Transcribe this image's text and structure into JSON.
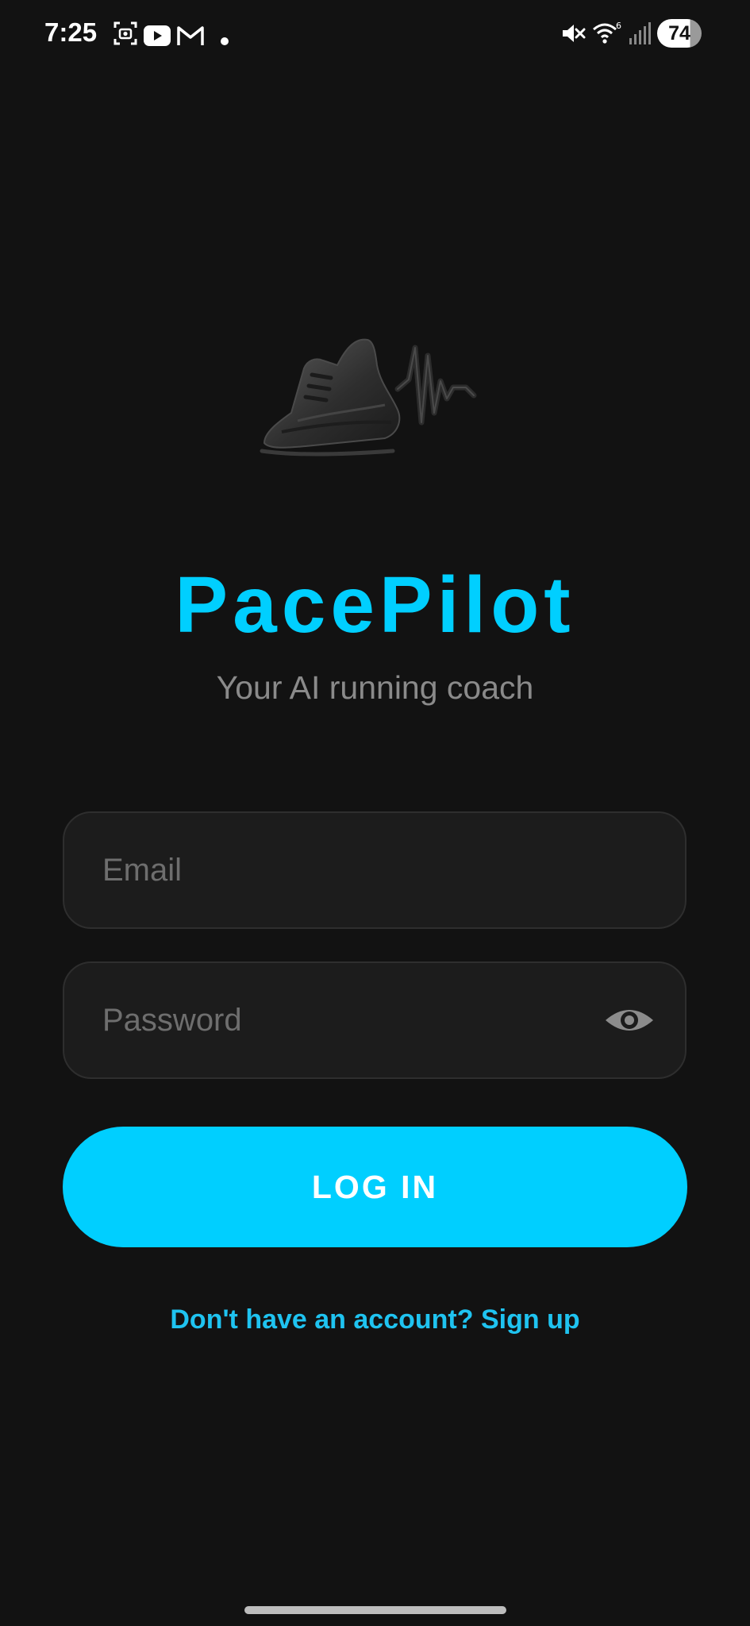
{
  "status_bar": {
    "time": "7:25",
    "battery_level": "74",
    "notification_icons": [
      "screenshot-icon",
      "youtube-icon",
      "gmail-icon",
      "dot-icon"
    ],
    "system_icons": [
      "vibrate-mute-icon",
      "wifi-6-icon",
      "signal-icon",
      "battery-icon"
    ]
  },
  "branding": {
    "logo_icon": "running-shoe-heartbeat-icon",
    "title": "PacePilot",
    "subtitle": "Your AI running coach"
  },
  "form": {
    "email_placeholder": "Email",
    "email_value": "",
    "password_placeholder": "Password",
    "password_value": "",
    "password_toggle_icon": "eye-icon",
    "login_label": "LOG IN",
    "signup_link": "Don't have an account? Sign up"
  },
  "colors": {
    "background": "#121212",
    "accent": "#00cfff",
    "field_bg": "#1c1c1c",
    "placeholder": "#6e6e6e",
    "subtitle": "#8a8a8a"
  }
}
